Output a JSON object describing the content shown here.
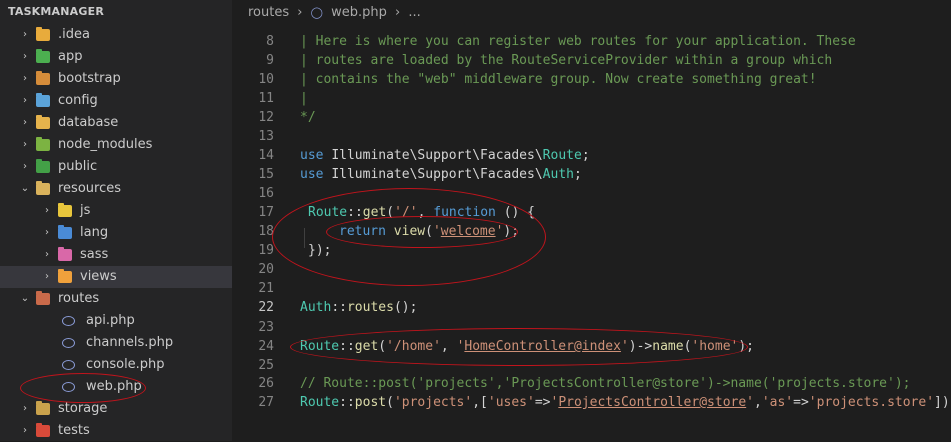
{
  "explorer": {
    "title": "TASKMANAGER",
    "items": [
      {
        "label": ".idea",
        "kind": "folder",
        "color": "#e8ab3c",
        "chev": "›"
      },
      {
        "label": "app",
        "kind": "folder",
        "color": "#4caf50",
        "chev": "›"
      },
      {
        "label": "bootstrap",
        "kind": "folder",
        "color": "#d58c3a",
        "chev": "›"
      },
      {
        "label": "config",
        "kind": "folder",
        "color": "#5ba3d9",
        "chev": "›"
      },
      {
        "label": "database",
        "kind": "folder",
        "color": "#e6b34c",
        "chev": "›"
      },
      {
        "label": "node_modules",
        "kind": "folder",
        "color": "#7cb342",
        "chev": "›"
      },
      {
        "label": "public",
        "kind": "folder",
        "color": "#43a047",
        "chev": "›"
      },
      {
        "label": "resources",
        "kind": "folder-open",
        "color": "#d9b25c",
        "chev": "⌄"
      },
      {
        "label": "js",
        "kind": "folder",
        "color": "#e8c63c",
        "chev": "›"
      },
      {
        "label": "lang",
        "kind": "folder",
        "color": "#4a8bd6",
        "chev": "›"
      },
      {
        "label": "sass",
        "kind": "folder",
        "color": "#d968a8",
        "chev": "›"
      },
      {
        "label": "views",
        "kind": "folder",
        "color": "#f0a13c",
        "chev": "›"
      },
      {
        "label": "routes",
        "kind": "folder-open",
        "color": "#c96a4a",
        "chev": "⌄"
      },
      {
        "label": "api.php",
        "kind": "php",
        "color": "#8a9bd6",
        "chev": ""
      },
      {
        "label": "channels.php",
        "kind": "php",
        "color": "#8a9bd6",
        "chev": ""
      },
      {
        "label": "console.php",
        "kind": "php",
        "color": "#8a9bd6",
        "chev": ""
      },
      {
        "label": "web.php",
        "kind": "php",
        "color": "#8a9bd6",
        "chev": ""
      },
      {
        "label": "storage",
        "kind": "folder",
        "color": "#c9a24c",
        "chev": "›"
      },
      {
        "label": "tests",
        "kind": "folder",
        "color": "#d84a3a",
        "chev": "›"
      }
    ]
  },
  "breadcrumb": {
    "folder": "routes",
    "sep": "›",
    "file": "web.php",
    "more": "..."
  },
  "line_numbers": [
    "8",
    "9",
    "10",
    "11",
    "12",
    "13",
    "14",
    "15",
    "16",
    "17",
    "18",
    "19",
    "20",
    "21",
    "22",
    "23",
    "24",
    "25",
    "26",
    "27"
  ],
  "code": {
    "l8": "| Here is where you can register web routes for your application. These",
    "l9": "| routes are loaded by the RouteServiceProvider within a group which",
    "l10": "| contains the \"web\" middleware group. Now create something great!",
    "l11": "|",
    "l12": "*/",
    "use": "use",
    "ns1": "Illuminate",
    "bs": "\\",
    "ns2": "Support",
    "ns3": "Facades",
    "route": "Route",
    "auth": "Auth",
    "semi": ";",
    "dc": "::",
    "get": "get",
    "post": "post",
    "routes_fn": "routes",
    "lp": "(",
    "rp": ")",
    "comma": ", ",
    "comma2": ",",
    "slash_str": "'/'",
    "function_kw": "function",
    "fn_args": " () {",
    "return_kw": "return",
    "view_fn": "view",
    "q": "'",
    "welcome": "welcome",
    "close": "});",
    "home_path": "'/home'",
    "home_ctrl": "HomeController@index",
    "arrow": "->",
    "name_fn": "name",
    "home_name": "'home'",
    "l26_comment": "// Route::post('projects','ProjectsController@store')->name('projects.store');",
    "projects": "'projects'",
    "lb": "[",
    "rb": "]",
    "uses": "'uses'",
    "fat": "=>",
    "proj_ctrl": "ProjectsController@store",
    "as": "'as'",
    "proj_store": "'projects.store'",
    "end": ");"
  }
}
